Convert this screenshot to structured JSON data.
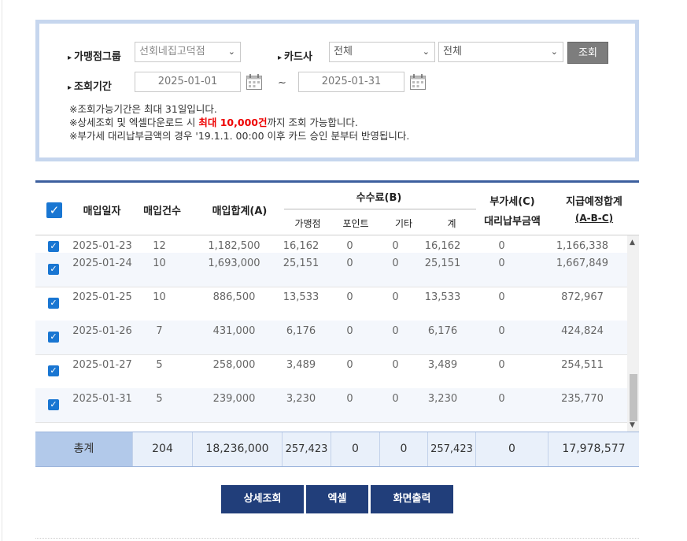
{
  "filter": {
    "group_label": "가맹점그룹",
    "group_value": "선회네집고덕점",
    "card_label": "카드사",
    "card_value1": "전체",
    "card_value2": "전체",
    "search_button": "조회",
    "period_label": "조회기간",
    "date_from": "2025-01-01",
    "date_to": "2025-01-31",
    "tilde": "~",
    "notes": {
      "n1": "※조회가능기간은 최대 31일입니다.",
      "n2_pre": "※상세조회 및 엑셀다운로드 시 ",
      "n2_red": "최대 10,000건",
      "n2_post": "까지 조회 가능합니다.",
      "n3": "※부가세 대리납부금액의 경우 '19.1.1. 00:00 이후 카드 승인 분부터 반영됩니다."
    }
  },
  "table": {
    "headers": {
      "date": "매입일자",
      "count": "매입건수",
      "sum": "매입합계(A)",
      "fee": "수수료(B)",
      "fee_merchant": "가맹점",
      "fee_point": "포인트",
      "fee_other": "기타",
      "fee_total": "계",
      "vat1": "부가세(C)",
      "vat2": "대리납부금액",
      "pay1": "지급예정합계",
      "pay2": "(A-B-C)"
    },
    "rows": [
      {
        "date": "2025-01-23",
        "count": "12",
        "sum": "1,182,500",
        "merchant": "16,162",
        "point": "0",
        "other": "0",
        "fee": "16,162",
        "vat": "0",
        "pay": "1,166,338"
      },
      {
        "date": "2025-01-24",
        "count": "10",
        "sum": "1,693,000",
        "merchant": "25,151",
        "point": "0",
        "other": "0",
        "fee": "25,151",
        "vat": "0",
        "pay": "1,667,849"
      },
      {
        "date": "2025-01-25",
        "count": "10",
        "sum": "886,500",
        "merchant": "13,533",
        "point": "0",
        "other": "0",
        "fee": "13,533",
        "vat": "0",
        "pay": "872,967"
      },
      {
        "date": "2025-01-26",
        "count": "7",
        "sum": "431,000",
        "merchant": "6,176",
        "point": "0",
        "other": "0",
        "fee": "6,176",
        "vat": "0",
        "pay": "424,824"
      },
      {
        "date": "2025-01-27",
        "count": "5",
        "sum": "258,000",
        "merchant": "3,489",
        "point": "0",
        "other": "0",
        "fee": "3,489",
        "vat": "0",
        "pay": "254,511"
      },
      {
        "date": "2025-01-31",
        "count": "5",
        "sum": "239,000",
        "merchant": "3,230",
        "point": "0",
        "other": "0",
        "fee": "3,230",
        "vat": "0",
        "pay": "235,770"
      }
    ],
    "total": {
      "label": "총계",
      "count": "204",
      "sum": "18,236,000",
      "merchant": "257,423",
      "point": "0",
      "other": "0",
      "fee": "257,423",
      "vat": "0",
      "pay": "17,978,577"
    }
  },
  "buttons": {
    "detail": "상세조회",
    "excel": "엑셀",
    "print": "화면출력"
  },
  "colors": {
    "accent": "#1976d2",
    "button": "#213e7a",
    "header_bar": "#3c5f9e"
  }
}
